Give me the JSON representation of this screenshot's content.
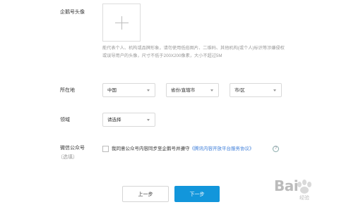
{
  "avatar": {
    "label": "企鹅号头像",
    "hint": "能代表个人、机构或品牌形象，请勿使用低俗图片、二维码、其他机构(或个人)标识等涉嫌侵权或误导用户的头像，尺寸不低于200X200像素，大小不超过5M"
  },
  "location": {
    "label": "所在地",
    "country": "中国",
    "province": "省份/直辖市",
    "city": "市/区"
  },
  "field": {
    "label": "领域",
    "placeholder": "请选择"
  },
  "wechat": {
    "label": "微信公众号",
    "optional": "（选填）",
    "agree_text": "我同意公众号内容同步至企鹅号并遵守",
    "agree_link": "《腾讯内容开放平台服务协议》",
    "help": "?"
  },
  "buttons": {
    "prev": "上一步",
    "next": "下一步"
  },
  "watermark": {
    "text": "Bai",
    "sub": "经验"
  },
  "colors": {
    "primary": "#1296db",
    "link": "#3c7dd9"
  }
}
